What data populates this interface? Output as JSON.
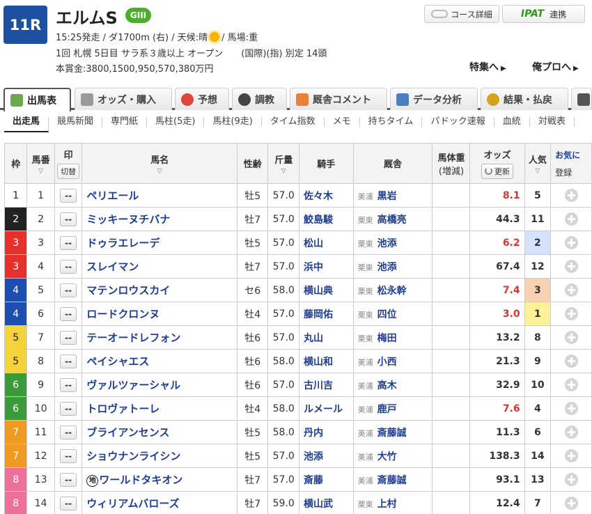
{
  "race": {
    "number": "11R",
    "name": "エルムS",
    "grade": "GIII",
    "info_before_weather": "15:25発走 / ダ1700m (右) / 天候:晴",
    "info_after_weather": "/ 馬場:重",
    "conditions": "1回 札幌 5日目 サラ系３歳以上 オープン　　(国際)(指) 別定 14頭",
    "prize": "本賞金:3800,1500,950,570,380万円",
    "weather_icon": "sun-icon"
  },
  "header_buttons": {
    "course": "コース詳細",
    "ipat_logo": "IPAT",
    "ipat": "連携"
  },
  "header_links": {
    "tokushu": "特集へ",
    "orepro": "俺プロへ"
  },
  "tabs": [
    "出馬表",
    "オッズ・購入",
    "予想",
    "調教",
    "厩舎コメント",
    "データ分析",
    "結果・払戻"
  ],
  "subnav": [
    "出走馬",
    "競馬新聞",
    "専門紙",
    "馬柱(5走)",
    "馬柱(9走)",
    "タイム指数",
    "メモ",
    "持ちタイム",
    "パドック速報",
    "血統",
    "対戦表"
  ],
  "columns": {
    "waku": "枠",
    "umaban": "馬番",
    "mark": "印",
    "mark_btn": "切替",
    "name": "馬名",
    "sex_age": "性齢",
    "weight": "斤量",
    "jockey": "騎手",
    "trainer": "厩舎",
    "body_weight": "馬体重",
    "body_weight_sub": "(増減)",
    "odds": "オッズ",
    "odds_btn": "更新",
    "popularity": "人気",
    "favorite": "お気に",
    "favorite_btn": "登録"
  },
  "horses": [
    {
      "waku": "1",
      "umaban": "1",
      "mark": "--",
      "name": "ペリエール",
      "chihou": "",
      "sex_age": "牡5",
      "weight": "57.0",
      "jockey": "佐々木",
      "loc": "美浦",
      "trainer": "黒岩",
      "odds": "8.1",
      "pop": "5"
    },
    {
      "waku": "2",
      "umaban": "2",
      "mark": "--",
      "name": "ミッキーヌチバナ",
      "chihou": "",
      "sex_age": "牡7",
      "weight": "57.0",
      "jockey": "鮫島駿",
      "loc": "栗東",
      "trainer": "高橋亮",
      "odds": "44.3",
      "pop": "11"
    },
    {
      "waku": "3",
      "umaban": "3",
      "mark": "--",
      "name": "ドゥラエレーデ",
      "chihou": "",
      "sex_age": "牡5",
      "weight": "57.0",
      "jockey": "松山",
      "loc": "栗東",
      "trainer": "池添",
      "odds": "6.2",
      "pop": "2"
    },
    {
      "waku": "3",
      "umaban": "4",
      "mark": "--",
      "name": "スレイマン",
      "chihou": "",
      "sex_age": "牡7",
      "weight": "57.0",
      "jockey": "浜中",
      "loc": "栗東",
      "trainer": "池添",
      "odds": "67.4",
      "pop": "12"
    },
    {
      "waku": "4",
      "umaban": "5",
      "mark": "--",
      "name": "マテンロウスカイ",
      "chihou": "",
      "sex_age": "セ6",
      "weight": "58.0",
      "jockey": "横山典",
      "loc": "栗東",
      "trainer": "松永幹",
      "odds": "7.4",
      "pop": "3"
    },
    {
      "waku": "4",
      "umaban": "6",
      "mark": "--",
      "name": "ロードクロンヌ",
      "chihou": "",
      "sex_age": "牡4",
      "weight": "57.0",
      "jockey": "藤岡佑",
      "loc": "栗東",
      "trainer": "四位",
      "odds": "3.0",
      "pop": "1"
    },
    {
      "waku": "5",
      "umaban": "7",
      "mark": "--",
      "name": "テーオードレフォン",
      "chihou": "",
      "sex_age": "牡6",
      "weight": "57.0",
      "jockey": "丸山",
      "loc": "栗東",
      "trainer": "梅田",
      "odds": "13.2",
      "pop": "8"
    },
    {
      "waku": "5",
      "umaban": "8",
      "mark": "--",
      "name": "ペイシャエス",
      "chihou": "",
      "sex_age": "牡6",
      "weight": "58.0",
      "jockey": "横山和",
      "loc": "美浦",
      "trainer": "小西",
      "odds": "21.3",
      "pop": "9"
    },
    {
      "waku": "6",
      "umaban": "9",
      "mark": "--",
      "name": "ヴァルツァーシャル",
      "chihou": "",
      "sex_age": "牡6",
      "weight": "57.0",
      "jockey": "古川吉",
      "loc": "美浦",
      "trainer": "高木",
      "odds": "32.9",
      "pop": "10"
    },
    {
      "waku": "6",
      "umaban": "10",
      "mark": "--",
      "name": "トロヴァトーレ",
      "chihou": "",
      "sex_age": "牡4",
      "weight": "58.0",
      "jockey": "ルメール",
      "loc": "美浦",
      "trainer": "鹿戸",
      "odds": "7.6",
      "pop": "4"
    },
    {
      "waku": "7",
      "umaban": "11",
      "mark": "--",
      "name": "ブライアンセンス",
      "chihou": "",
      "sex_age": "牡5",
      "weight": "58.0",
      "jockey": "丹内",
      "loc": "美浦",
      "trainer": "斎藤誠",
      "odds": "11.3",
      "pop": "6"
    },
    {
      "waku": "7",
      "umaban": "12",
      "mark": "--",
      "name": "ショウナンライシン",
      "chihou": "",
      "sex_age": "牡5",
      "weight": "57.0",
      "jockey": "池添",
      "loc": "美浦",
      "trainer": "大竹",
      "odds": "138.3",
      "pop": "14"
    },
    {
      "waku": "8",
      "umaban": "13",
      "mark": "--",
      "name": "ワールドタキオン",
      "chihou": "地",
      "sex_age": "牡7",
      "weight": "57.0",
      "jockey": "斎藤",
      "loc": "美浦",
      "trainer": "斎藤誠",
      "odds": "93.1",
      "pop": "13"
    },
    {
      "waku": "8",
      "umaban": "14",
      "mark": "--",
      "name": "ウィリアムバローズ",
      "chihou": "",
      "sex_age": "牡7",
      "weight": "59.0",
      "jockey": "横山武",
      "loc": "栗東",
      "trainer": "上村",
      "odds": "12.4",
      "pop": "7"
    }
  ]
}
